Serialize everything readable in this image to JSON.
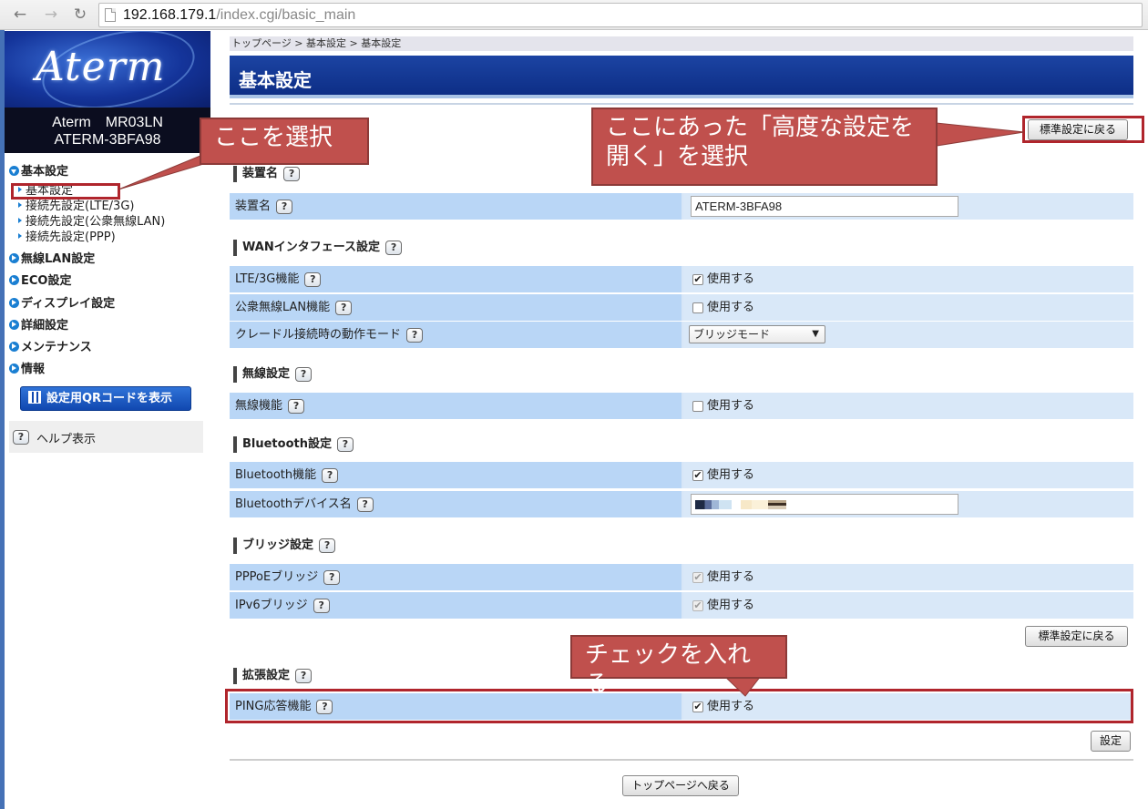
{
  "browser": {
    "back_icon": "arrow-left-icon",
    "forward_icon": "arrow-right-icon",
    "reload_icon": "reload-icon",
    "url_host": "192.168.179.1",
    "url_path": "/index.cgi/basic_main"
  },
  "sidebar": {
    "logo_text": "Aterm",
    "model_line1": "Aterm　MR03LN",
    "model_line2": "ATERM-3BFA98",
    "sections": [
      {
        "label": "基本設定",
        "open": true
      },
      {
        "label": "無線LAN設定"
      },
      {
        "label": "ECO設定"
      },
      {
        "label": "ディスプレイ設定"
      },
      {
        "label": "詳細設定"
      },
      {
        "label": "メンテナンス"
      },
      {
        "label": "情報"
      }
    ],
    "sub_items": [
      {
        "label": "基本設定",
        "selected": true
      },
      {
        "label": "接続先設定(LTE/3G)"
      },
      {
        "label": "接続先設定(公衆無線LAN)"
      },
      {
        "label": "接続先設定(PPP)"
      }
    ],
    "qr_button": "設定用QRコードを表示",
    "help_label": "ヘルプ表示"
  },
  "main": {
    "breadcrumb": "トップページ > 基本設定 > 基本設定",
    "title": "基本設定",
    "std_button": "標準設定に戻る",
    "set_button": "設定",
    "top_button": "トップページへ戻る",
    "help_mark": "?",
    "use_label": "使用する",
    "sections": {
      "device": "装置名",
      "wan": "WANインタフェース設定",
      "wireless": "無線設定",
      "bluetooth": "Bluetooth設定",
      "bridge": "ブリッジ設定",
      "extended": "拡張設定"
    },
    "rows": {
      "device_name": {
        "label": "装置名",
        "value": "ATERM-3BFA98"
      },
      "lte": {
        "label": "LTE/3G機能",
        "checked": true
      },
      "public_lan": {
        "label": "公衆無線LAN機能",
        "checked": false
      },
      "cradle": {
        "label": "クレードル接続時の動作モード",
        "value": "ブリッジモード"
      },
      "wireless": {
        "label": "無線機能",
        "checked": false
      },
      "bt": {
        "label": "Bluetooth機能",
        "checked": true
      },
      "bt_name": {
        "label": "Bluetoothデバイス名"
      },
      "pppoe": {
        "label": "PPPoEブリッジ",
        "checked": true,
        "disabled": true
      },
      "ipv6": {
        "label": "IPv6ブリッジ",
        "checked": true,
        "disabled": true
      },
      "ping": {
        "label": "PING応答機能",
        "checked": true
      }
    }
  },
  "annotations": {
    "select_here": "ここを選択",
    "advanced_line1": "ここにあった「高度な設定を",
    "advanced_line2": "開く」を選択",
    "check_it": "チェックを入れる",
    "color": "#c0504d"
  }
}
